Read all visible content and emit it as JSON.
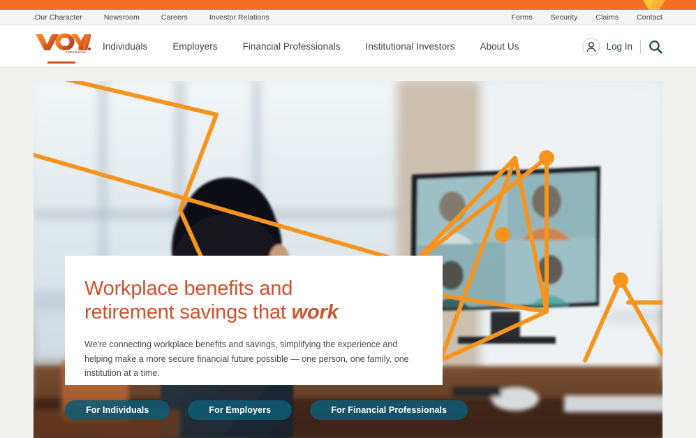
{
  "brand": {
    "logo_text": "VOYA",
    "logo_subtext": "FINANCIAL",
    "accent_orange": "#f36f21",
    "accent_gold": "#f9b233",
    "heading_orange": "#d1502c",
    "teal": "#0f5a73",
    "logo_gradient_start": "#f58220",
    "logo_gradient_end": "#b03a2e"
  },
  "utility_nav": {
    "left_links": [
      {
        "label": "Our Character"
      },
      {
        "label": "Newsroom"
      },
      {
        "label": "Careers"
      },
      {
        "label": "Investor Relations"
      }
    ],
    "right_links": [
      {
        "label": "Forms"
      },
      {
        "label": "Security"
      },
      {
        "label": "Claims"
      },
      {
        "label": "Contact"
      }
    ]
  },
  "main_nav": {
    "items": [
      {
        "label": "Individuals"
      },
      {
        "label": "Employers"
      },
      {
        "label": "Financial Professionals"
      },
      {
        "label": "Institutional Investors"
      },
      {
        "label": "About Us"
      }
    ]
  },
  "header_actions": {
    "login_label": "Log In",
    "account_icon": "user-circle-icon",
    "search_icon": "search-icon"
  },
  "hero": {
    "title_line1": "Workplace benefits and",
    "title_line2_pre": "retirement savings that ",
    "title_line2_italic": "work",
    "body": "We're connecting workplace benefits and savings, simplifying the experience and helping make a more secure financial future possible — one person, one family, one institution at a time.",
    "buttons": [
      {
        "label": "For Individuals"
      },
      {
        "label": "For Employers"
      },
      {
        "label": "For Financial Professionals"
      }
    ]
  }
}
